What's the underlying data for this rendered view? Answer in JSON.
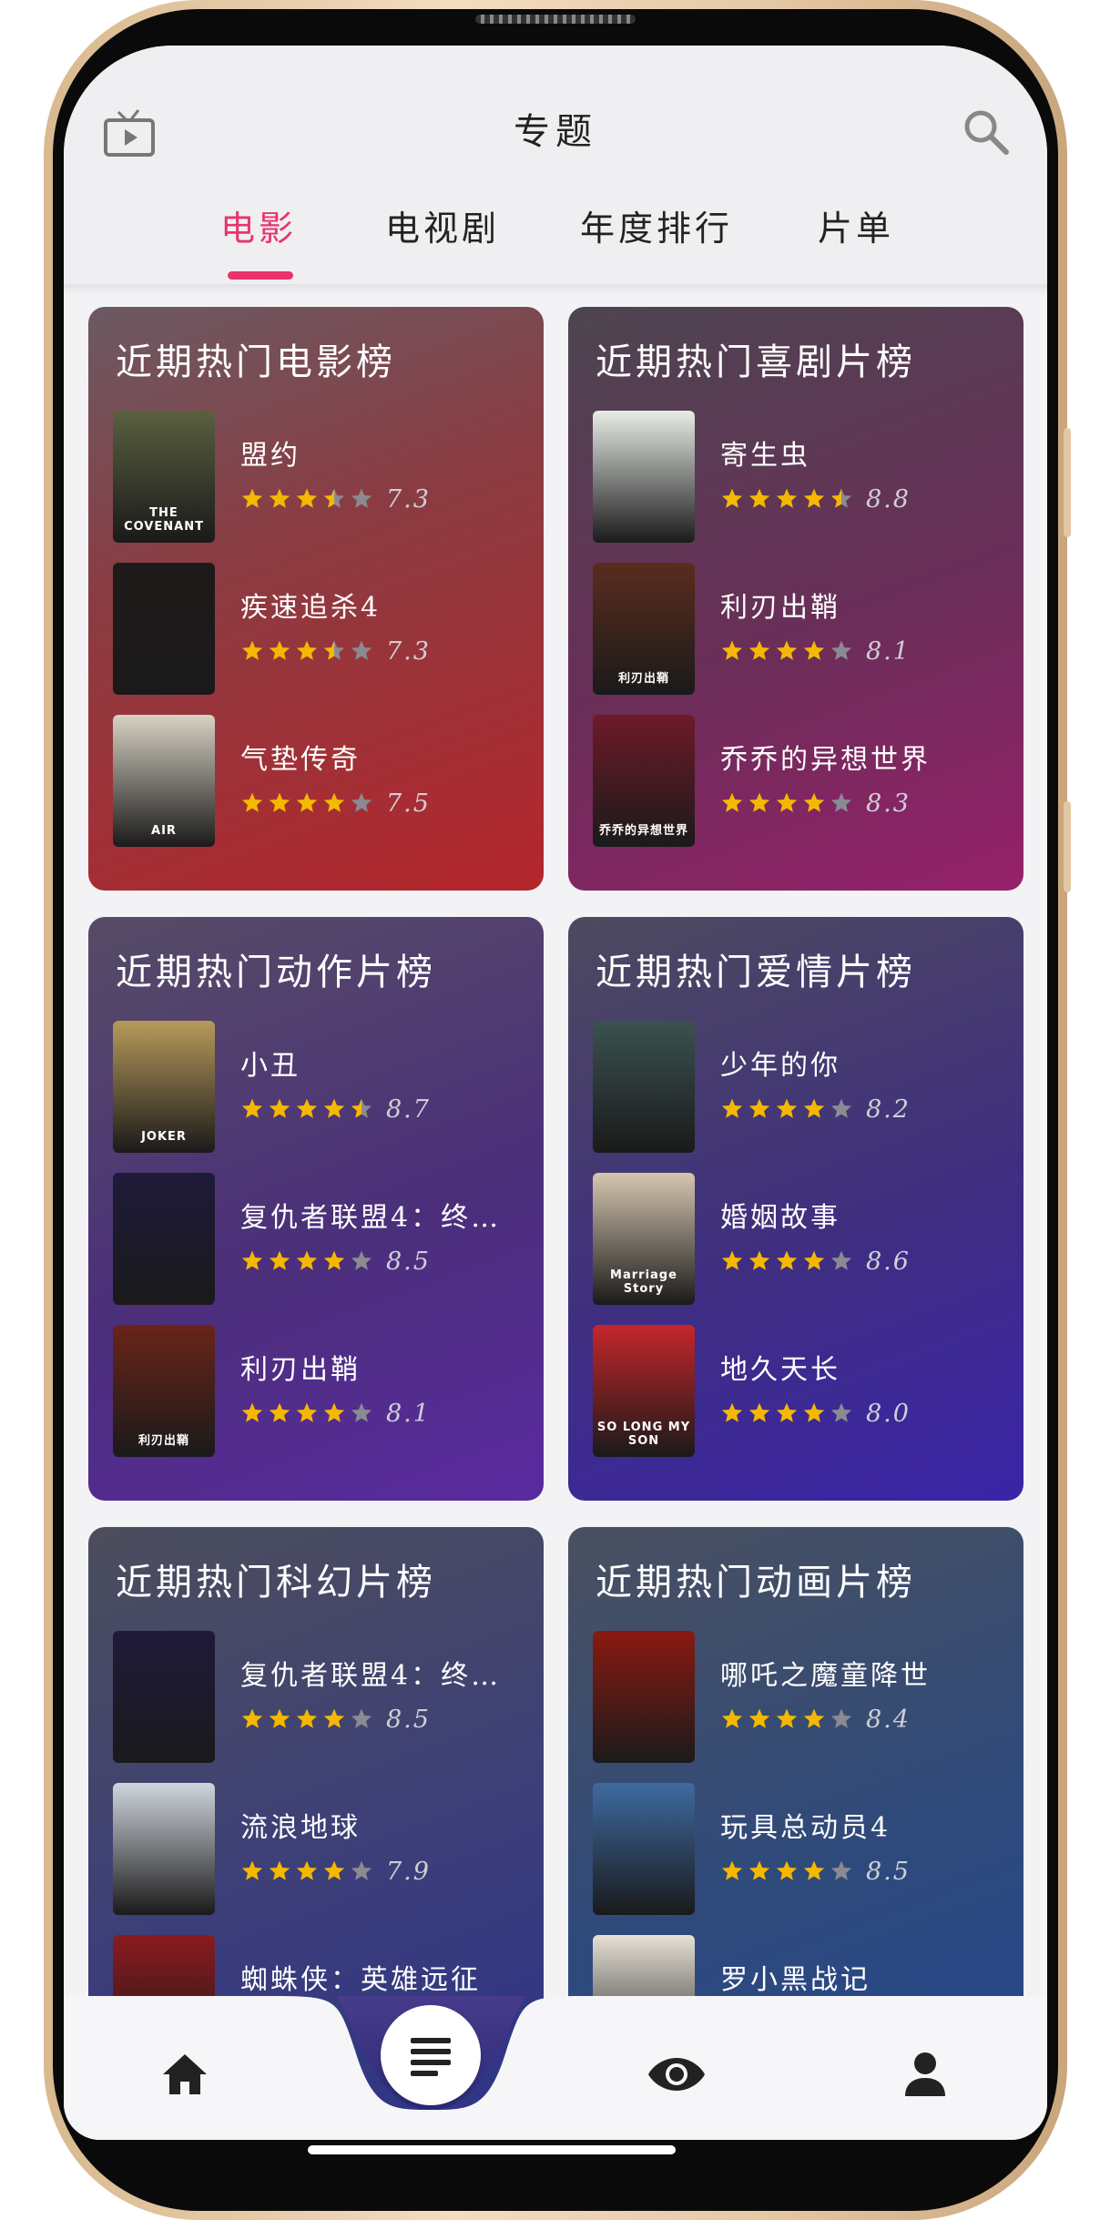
{
  "header": {
    "title": "专题",
    "tabs": [
      {
        "label": "电影",
        "active": true
      },
      {
        "label": "电视剧",
        "active": false
      },
      {
        "label": "年度排行",
        "active": false
      },
      {
        "label": "片单",
        "active": false
      }
    ]
  },
  "accent_color": "#e8346c",
  "star_color": "#f5b800",
  "cards": [
    {
      "title": "近期热门电影榜",
      "items": [
        {
          "name": "盟约",
          "score": "7.3",
          "stars": 3.5,
          "poster_text": "THE COVENANT"
        },
        {
          "name": "疾速追杀4",
          "score": "7.3",
          "stars": 3.5,
          "poster_text": ""
        },
        {
          "name": "气垫传奇",
          "score": "7.5",
          "stars": 4,
          "poster_text": "AIR"
        }
      ]
    },
    {
      "title": "近期热门喜剧片榜",
      "items": [
        {
          "name": "寄生虫",
          "score": "8.8",
          "stars": 4.5,
          "poster_text": ""
        },
        {
          "name": "利刃出鞘",
          "score": "8.1",
          "stars": 4,
          "poster_text": "利刃出鞘"
        },
        {
          "name": "乔乔的异想世界",
          "score": "8.3",
          "stars": 4,
          "poster_text": "乔乔的异想世界"
        }
      ]
    },
    {
      "title": "近期热门动作片榜",
      "items": [
        {
          "name": "小丑",
          "score": "8.7",
          "stars": 4.5,
          "poster_text": "JOKER"
        },
        {
          "name": "复仇者联盟4：终…",
          "score": "8.5",
          "stars": 4,
          "poster_text": ""
        },
        {
          "name": "利刃出鞘",
          "score": "8.1",
          "stars": 4,
          "poster_text": "利刃出鞘"
        }
      ]
    },
    {
      "title": "近期热门爱情片榜",
      "items": [
        {
          "name": "少年的你",
          "score": "8.2",
          "stars": 4,
          "poster_text": ""
        },
        {
          "name": "婚姻故事",
          "score": "8.6",
          "stars": 4,
          "poster_text": "Marriage Story"
        },
        {
          "name": "地久天长",
          "score": "8.0",
          "stars": 4,
          "poster_text": "SO LONG MY SON"
        }
      ]
    },
    {
      "title": "近期热门科幻片榜",
      "items": [
        {
          "name": "复仇者联盟4：终…",
          "score": "8.5",
          "stars": 4,
          "poster_text": ""
        },
        {
          "name": "流浪地球",
          "score": "7.9",
          "stars": 4,
          "poster_text": ""
        },
        {
          "name": "蜘蛛侠：英雄远征",
          "score": "",
          "stars": 0,
          "poster_text": ""
        }
      ]
    },
    {
      "title": "近期热门动画片榜",
      "items": [
        {
          "name": "哪吒之魔童降世",
          "score": "8.4",
          "stars": 4,
          "poster_text": ""
        },
        {
          "name": "玩具总动员4",
          "score": "8.5",
          "stars": 4,
          "poster_text": ""
        },
        {
          "name": "罗小黑战记",
          "score": "",
          "stars": 0,
          "poster_text": ""
        }
      ]
    }
  ],
  "bottom_nav": [
    {
      "icon": "home-icon"
    },
    {
      "icon": "list-icon"
    },
    {
      "icon": "eye-icon"
    },
    {
      "icon": "person-icon"
    }
  ]
}
